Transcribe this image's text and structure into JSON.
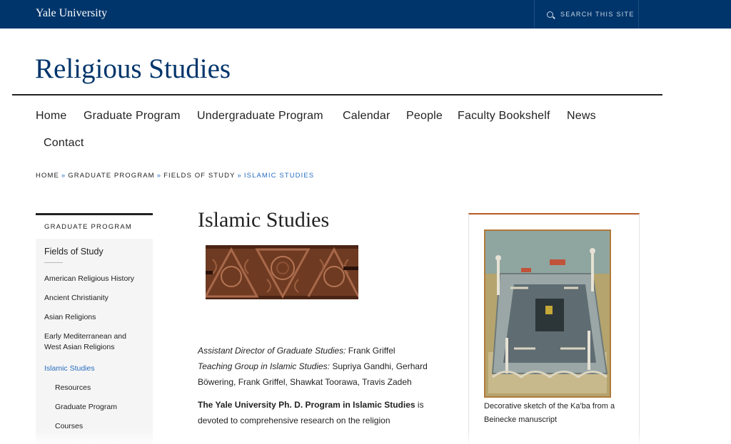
{
  "header": {
    "university": "Yale University",
    "search_label": "SEARCH THIS SITE"
  },
  "site": {
    "title": "Religious Studies"
  },
  "nav": {
    "items": [
      {
        "label": "Home"
      },
      {
        "label": "Graduate Program"
      },
      {
        "label": "Undergraduate Program"
      },
      {
        "label": "Calendar"
      },
      {
        "label": "People"
      },
      {
        "label": "Faculty Bookshelf"
      },
      {
        "label": "News"
      },
      {
        "label": "Contact"
      }
    ]
  },
  "breadcrumb": {
    "items": [
      "HOME",
      "GRADUATE PROGRAM",
      "FIELDS OF STUDY"
    ],
    "separator": "»",
    "current": "ISLAMIC STUDIES"
  },
  "sidebar": {
    "heading": "GRADUATE PROGRAM",
    "section": "Fields of Study",
    "items": [
      {
        "label": "American Religious History"
      },
      {
        "label": "Ancient Christianity"
      },
      {
        "label": "Asian Religions"
      },
      {
        "label": "Early Mediterranean and West Asian Religions"
      },
      {
        "label": "Islamic Studies"
      },
      {
        "label": "Resources"
      },
      {
        "label": "Graduate Program"
      },
      {
        "label": "Courses"
      }
    ]
  },
  "main": {
    "title": "Islamic Studies",
    "ads_label": "Assistant Director of Graduate Studies:",
    "ads_name": " Frank Griffel",
    "teaching_label": "Teaching Group in Islamic Studies:",
    "teaching_names": " Supriya Gandhi, Gerhard Böwering, Frank Griffel, Shawkat Toorawa, Travis Zadeh",
    "program_bold": "The Yale University Ph. D. Program in Islamic Studies",
    "program_text": " is devoted to comprehensive research on the religion"
  },
  "sidecard": {
    "caption": "Decorative sketch of the Ka'ba from a Beinecke manuscript"
  },
  "colors": {
    "header_bg": "#00356b",
    "link_blue": "#286dc0",
    "card_accent": "#b45a2a"
  }
}
